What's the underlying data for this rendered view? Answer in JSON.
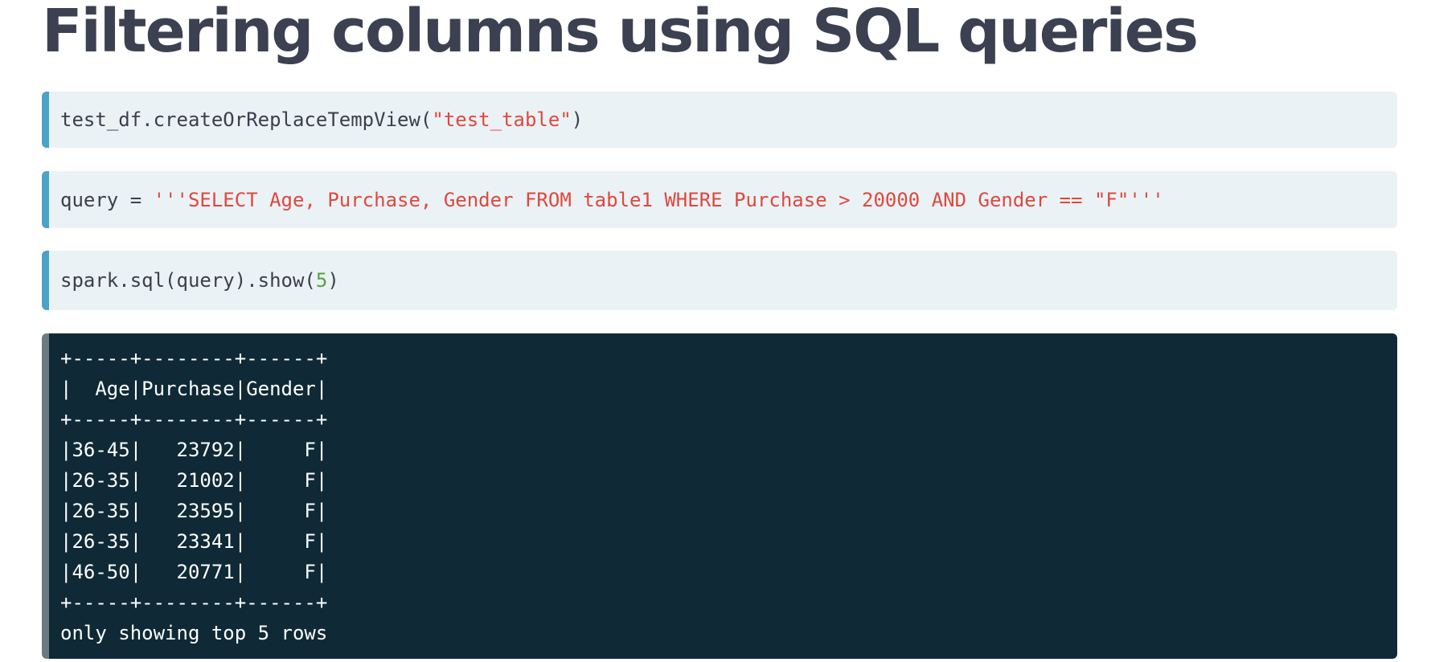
{
  "title": "Filtering columns using SQL queries",
  "cells": [
    {
      "tokens": [
        {
          "text": "test_df.createOrReplaceTempView(",
          "kind": "plain"
        },
        {
          "text": "\"test_table\"",
          "kind": "string"
        },
        {
          "text": ")",
          "kind": "plain"
        }
      ]
    },
    {
      "tokens": [
        {
          "text": "query = ",
          "kind": "plain"
        },
        {
          "text": "'''SELECT Age, Purchase, Gender FROM table1 WHERE Purchase > 20000 AND Gender == \"F\"'''",
          "kind": "string"
        }
      ]
    },
    {
      "tokens": [
        {
          "text": "spark.sql(query).show(",
          "kind": "plain"
        },
        {
          "text": "5",
          "kind": "number"
        },
        {
          "text": ")",
          "kind": "plain"
        }
      ]
    }
  ],
  "output": {
    "lines": [
      "+-----+--------+------+",
      "|  Age|Purchase|Gender|",
      "+-----+--------+------+",
      "|36-45|   23792|     F|",
      "|26-35|   21002|     F|",
      "|26-35|   23595|     F|",
      "|26-35|   23341|     F|",
      "|46-50|   20771|     F|",
      "+-----+--------+------+",
      "only showing top 5 rows"
    ]
  },
  "colors": {
    "title": "#3c4151",
    "code_background": "#eaf2f6",
    "code_accent": "#4aa3c9",
    "string": "#e0483c",
    "number": "#54a33f",
    "output_background": "#0f2a36",
    "output_text": "#ffffff"
  }
}
